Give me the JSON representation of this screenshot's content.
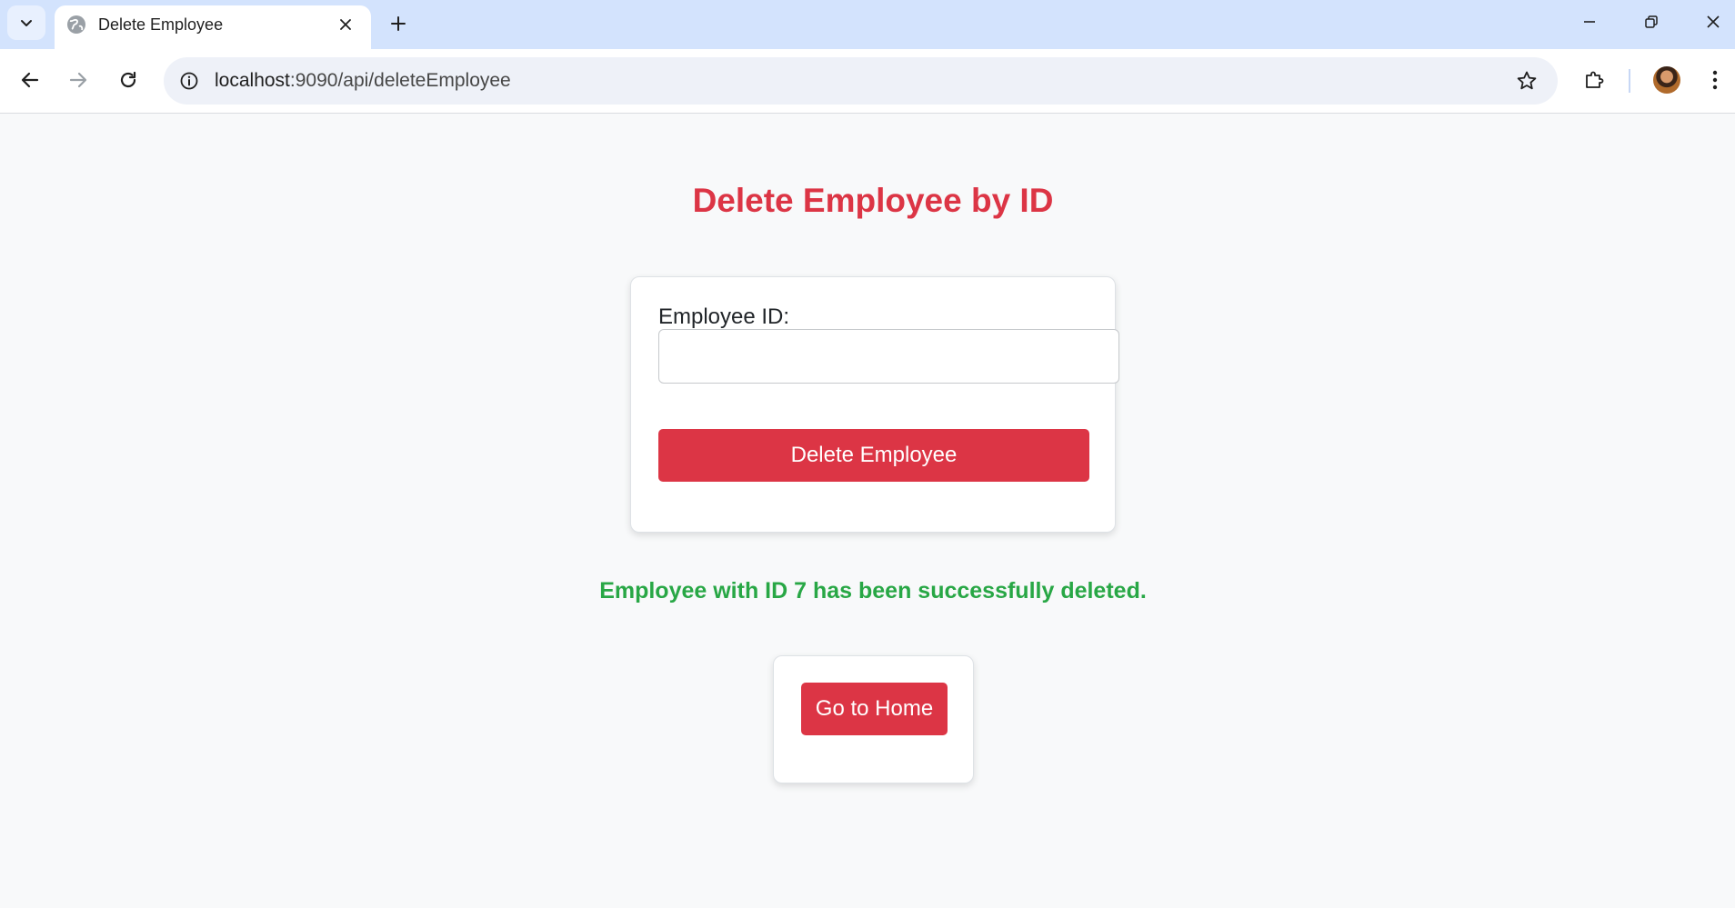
{
  "browser": {
    "tab_title": "Delete Employee",
    "url_host": "localhost",
    "url_path": ":9090/api/deleteEmployee",
    "icons": {
      "tab_search": "chevron-down-icon",
      "favicon": "globe-icon",
      "tab_close": "close-icon",
      "new_tab": "plus-icon",
      "minimize": "minimize-icon",
      "restore": "restore-icon",
      "close_window": "close-icon",
      "back": "back-arrow-icon",
      "forward": "forward-arrow-icon",
      "reload": "reload-icon",
      "site_info": "info-icon",
      "bookmark": "star-icon",
      "extensions": "puzzle-icon",
      "menu": "kebab-menu-icon"
    }
  },
  "page": {
    "title": "Delete Employee by ID",
    "form": {
      "label": "Employee ID:",
      "input_value": "",
      "input_placeholder": "",
      "submit_label": "Delete Employee"
    },
    "message": "Employee with ID 7 has been successfully deleted.",
    "home_button_label": "Go to Home"
  },
  "colors": {
    "accent": "#dc3545",
    "success": "#28a745",
    "tabstrip": "#d3e3fd",
    "page_bg": "#f8f9fa"
  }
}
